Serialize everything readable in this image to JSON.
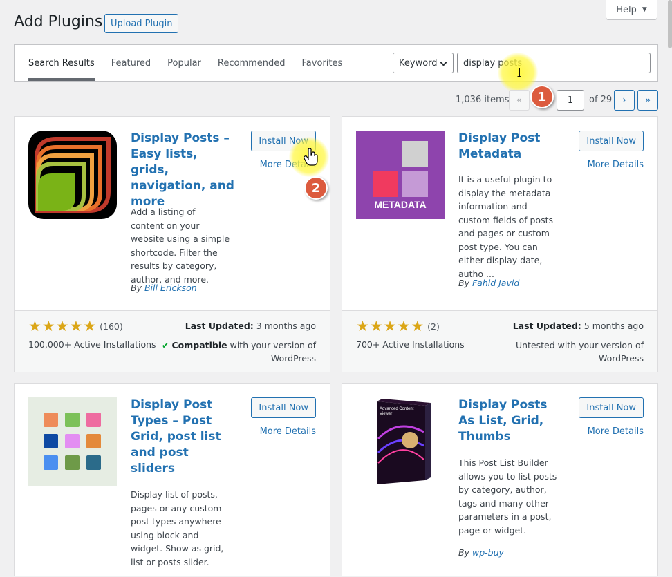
{
  "header": {
    "title": "Add Plugins",
    "upload_label": "Upload Plugin",
    "help_label": "Help"
  },
  "tabs": [
    {
      "label": "Search Results",
      "active": true
    },
    {
      "label": "Featured"
    },
    {
      "label": "Popular"
    },
    {
      "label": "Recommended"
    },
    {
      "label": "Favorites"
    }
  ],
  "search": {
    "type_label": "Keyword",
    "value": "display posts"
  },
  "pagination": {
    "items": "1,036 items",
    "first": "«",
    "prev": "‹",
    "current": "1",
    "of_label": "of 29",
    "next": "›",
    "last": "»"
  },
  "annotations": {
    "step1": "1",
    "step2": "2"
  },
  "plugins": [
    {
      "name": "Display Posts – Easy lists, grids, navigation, and more",
      "install_label": "Install Now",
      "details_label": "More Details",
      "description": "Add a listing of content on your website using a simple shortcode. Filter the results by category, author, and more.",
      "by_label": "By",
      "author": "Bill Erickson",
      "stars": 5,
      "rating_count": "(160)",
      "installs": "100,000+ Active Installations",
      "last_updated_label": "Last Updated:",
      "last_updated": "3 months ago",
      "compat_strong": "Compatible",
      "compat_rest": "with your version of WordPress"
    },
    {
      "name": "Display Post Metadata",
      "install_label": "Install Now",
      "details_label": "More Details",
      "description": "It is a useful plugin to display the metadata information and custom fields of posts and pages or custom post type. You can either display date, autho ...",
      "by_label": "By",
      "author": "Fahid Javid",
      "icon_text": "METADATA",
      "stars": 5,
      "rating_count": "(2)",
      "installs": "700+ Active Installations",
      "last_updated_label": "Last Updated:",
      "last_updated": "5 months ago",
      "compat_text": "Untested with your version of WordPress"
    },
    {
      "name": "Display Post Types – Post Grid, post list and post sliders",
      "install_label": "Install Now",
      "details_label": "More Details",
      "description": "Display list of posts, pages or any custom post types anywhere using block and widget. Show as grid, list or posts slider."
    },
    {
      "name": "Display Posts As List, Grid, Thumbs",
      "install_label": "Install Now",
      "details_label": "More Details",
      "description": "This Post List Builder allows you to list posts by category, author, tags and many other parameters in a post, page or widget.",
      "by_label": "By",
      "author": "wp-buy",
      "icon_text": "Advanced Content Viewer"
    }
  ],
  "colors": {
    "link": "#2271b1",
    "star": "#dba617",
    "badge": "#dc5b3e",
    "metadata_bg": "#8e44ad"
  }
}
